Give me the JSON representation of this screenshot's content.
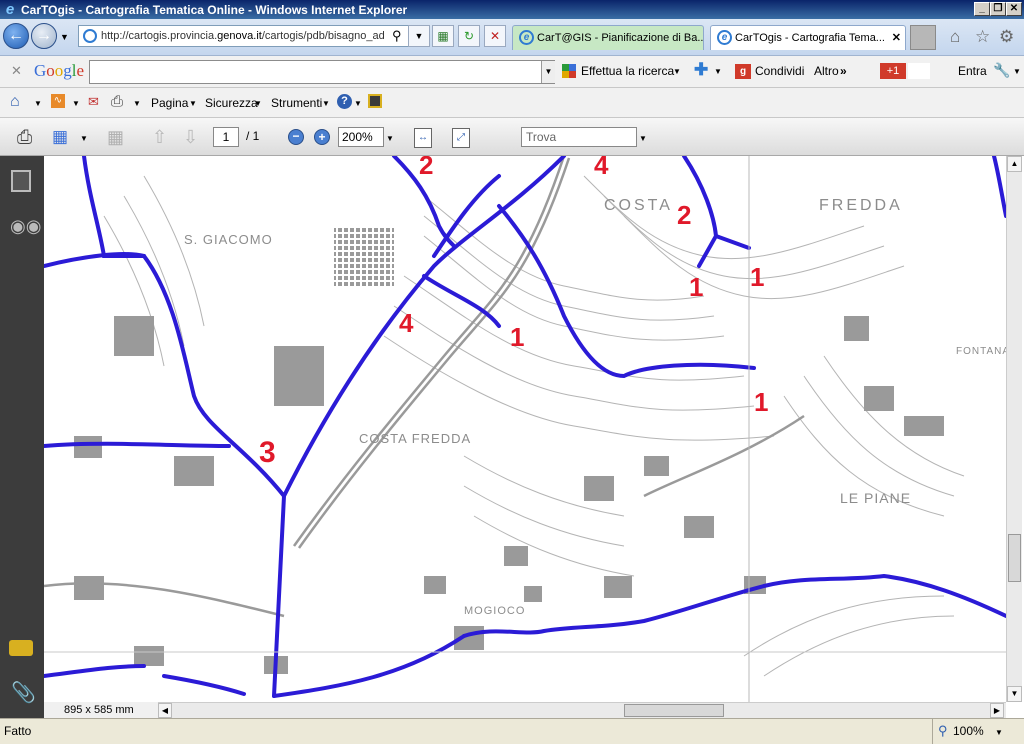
{
  "window": {
    "title": "CarTOgis - Cartografia Tematica Online - Windows Internet Explorer",
    "minimize": "_",
    "maximize": "❐",
    "close": "✕"
  },
  "nav": {
    "url_prefix": "http://cartogis.provincia.",
    "url_host": "genova.it",
    "url_suffix": "/cartogis/pdb/bisagno_ad",
    "tabs": [
      {
        "label": "CarT@GIS - Pianificazione di Ba..."
      },
      {
        "label": "CarTOgis - Cartografia Tema..."
      }
    ]
  },
  "google": {
    "logo": "Google",
    "search_value": "",
    "search_label": "Effettua la ricerca",
    "share_label": "Condividi",
    "more_label": "Altro",
    "plus_label": "+1",
    "signin_label": "Entra"
  },
  "commandbar": {
    "page_label": "Pagina",
    "security_label": "Sicurezza",
    "tools_label": "Strumenti"
  },
  "pdf": {
    "current_page": "1",
    "total_pages": "/ 1",
    "zoom": "200%",
    "find_placeholder": "Trova",
    "doc_size": "895 x 585 mm"
  },
  "map": {
    "labels": [
      {
        "text": "2"
      },
      {
        "text": "4"
      },
      {
        "text": "2"
      },
      {
        "text": "1"
      },
      {
        "text": "1"
      },
      {
        "text": "4"
      },
      {
        "text": "1"
      },
      {
        "text": "1"
      },
      {
        "text": "3"
      }
    ],
    "place_names": [
      {
        "text": "S. GIACOMO"
      },
      {
        "text": "COSTA"
      },
      {
        "text": "FREDDA"
      },
      {
        "text": "COSTA FREDDA"
      },
      {
        "text": "FONTANA"
      },
      {
        "text": "LE PIANE"
      },
      {
        "text": "MOGIOCO"
      }
    ],
    "colors": {
      "boundary": "#2b1bd6",
      "label": "#e0192a",
      "base": "#9a9a9a"
    }
  },
  "status": {
    "text": "Fatto",
    "zoom": "100%"
  }
}
